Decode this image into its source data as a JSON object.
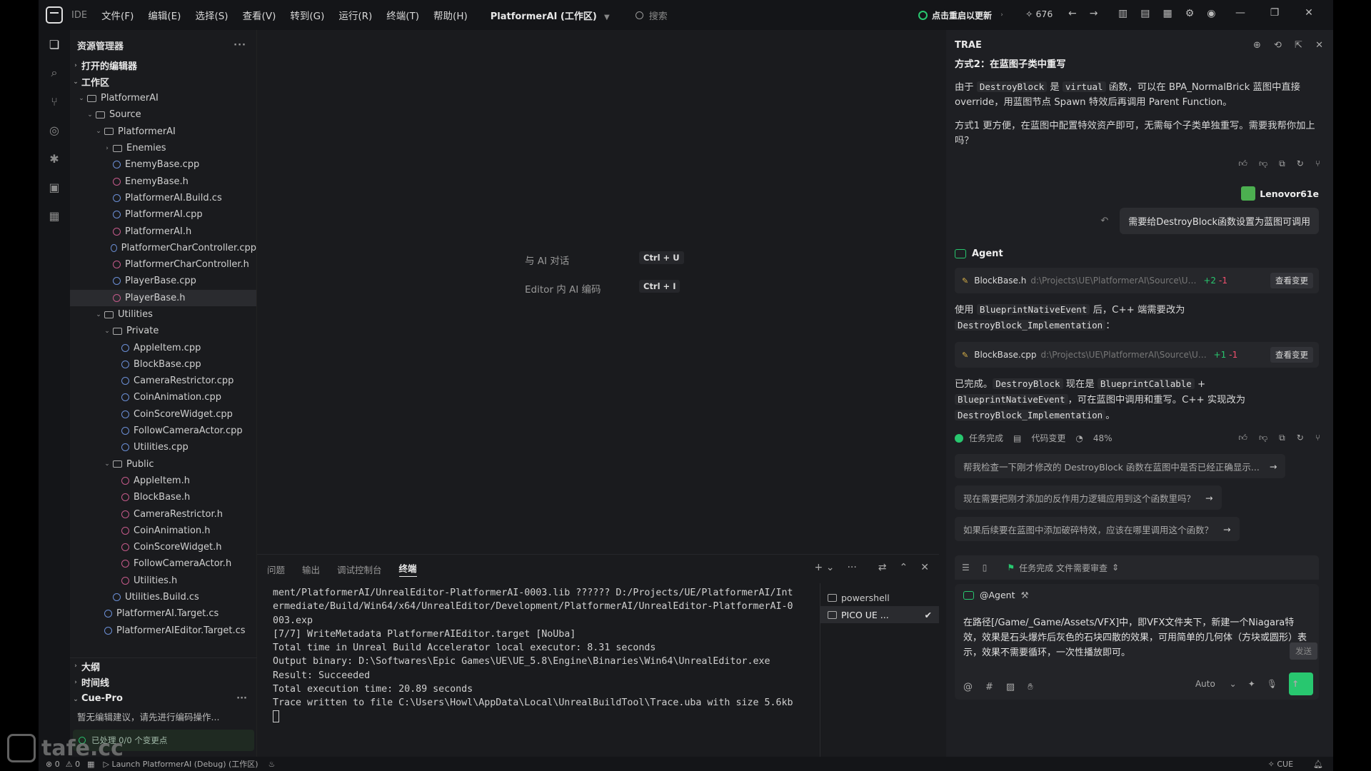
{
  "titlebar": {
    "ide": "IDE",
    "menus": [
      "文件(F)",
      "编辑(E)",
      "选择(S)",
      "查看(V)",
      "转到(G)",
      "运行(R)",
      "终端(T)",
      "帮助(H)"
    ],
    "workspace": "PlatformerAI (工作区)",
    "search_placeholder": "搜索",
    "update": "点击重启以更新",
    "spark_count": "676"
  },
  "explorer": {
    "title": "资源管理器",
    "open_editors": "打开的编辑器",
    "workspace": "工作区",
    "tree": [
      {
        "label": "PlatformerAI",
        "type": "folder",
        "depth": 0,
        "open": true
      },
      {
        "label": "Source",
        "type": "folder",
        "depth": 1,
        "open": true
      },
      {
        "label": "PlatformerAI",
        "type": "folder",
        "depth": 2,
        "open": true
      },
      {
        "label": "Enemies",
        "type": "folder",
        "depth": 3,
        "open": false
      },
      {
        "label": "EnemyBase.cpp",
        "type": "cpp",
        "depth": 3
      },
      {
        "label": "EnemyBase.h",
        "type": "h",
        "depth": 3
      },
      {
        "label": "PlatformerAI.Build.cs",
        "type": "cs",
        "depth": 3
      },
      {
        "label": "PlatformerAI.cpp",
        "type": "cpp",
        "depth": 3
      },
      {
        "label": "PlatformerAI.h",
        "type": "h",
        "depth": 3
      },
      {
        "label": "PlatformerCharController.cpp",
        "type": "cpp",
        "depth": 3
      },
      {
        "label": "PlatformerCharController.h",
        "type": "h",
        "depth": 3
      },
      {
        "label": "PlayerBase.cpp",
        "type": "cpp",
        "depth": 3
      },
      {
        "label": "PlayerBase.h",
        "type": "h",
        "depth": 3,
        "selected": true
      },
      {
        "label": "Utilities",
        "type": "folder",
        "depth": 2,
        "open": true
      },
      {
        "label": "Private",
        "type": "folder",
        "depth": 3,
        "open": true
      },
      {
        "label": "AppleItem.cpp",
        "type": "cpp",
        "depth": 4
      },
      {
        "label": "BlockBase.cpp",
        "type": "cpp",
        "depth": 4
      },
      {
        "label": "CameraRestrictor.cpp",
        "type": "cpp",
        "depth": 4
      },
      {
        "label": "CoinAnimation.cpp",
        "type": "cpp",
        "depth": 4
      },
      {
        "label": "CoinScoreWidget.cpp",
        "type": "cpp",
        "depth": 4
      },
      {
        "label": "FollowCameraActor.cpp",
        "type": "cpp",
        "depth": 4
      },
      {
        "label": "Utilities.cpp",
        "type": "cpp",
        "depth": 4
      },
      {
        "label": "Public",
        "type": "folder",
        "depth": 3,
        "open": true
      },
      {
        "label": "AppleItem.h",
        "type": "h",
        "depth": 4
      },
      {
        "label": "BlockBase.h",
        "type": "h",
        "depth": 4
      },
      {
        "label": "CameraRestrictor.h",
        "type": "h",
        "depth": 4
      },
      {
        "label": "CoinAnimation.h",
        "type": "h",
        "depth": 4
      },
      {
        "label": "CoinScoreWidget.h",
        "type": "h",
        "depth": 4
      },
      {
        "label": "FollowCameraActor.h",
        "type": "h",
        "depth": 4
      },
      {
        "label": "Utilities.h",
        "type": "h",
        "depth": 4
      },
      {
        "label": "Utilities.Build.cs",
        "type": "cs",
        "depth": 3
      },
      {
        "label": "PlatformerAI.Target.cs",
        "type": "cs",
        "depth": 2
      },
      {
        "label": "PlatformerAIEditor.Target.cs",
        "type": "cs",
        "depth": 2
      }
    ],
    "outline": "大纲",
    "timeline": "时间线",
    "cue_title": "Cue-Pro",
    "cue_msg": "暂无编辑建议，请先进行编码操作...",
    "cue_status": "已处理 0/0 个变更点"
  },
  "editor": {
    "shortcut1_label": "与 AI 对话",
    "shortcut1_keys": "Ctrl + U",
    "shortcut2_label": "Editor 内 AI 编码",
    "shortcut2_keys": "Ctrl + I"
  },
  "panel": {
    "tabs": [
      "问题",
      "输出",
      "调试控制台",
      "终端"
    ],
    "terminal_lines": [
      "ment/PlatformerAI/UnrealEditor-PlatformerAI-0003.lib ?????? D:/Projects/UE/PlatformerAI/Int",
      "ermediate/Build/Win64/x64/UnrealEditor/Development/PlatformerAI/UnrealEditor-PlatformerAI-0",
      "003.exp",
      "[7/7] WriteMetadata PlatformerAIEditor.target [NoUba]",
      "",
      "Total time in Unreal Build Accelerator local executor: 8.31 seconds",
      "Output binary: D:\\Softwares\\Epic Games\\UE\\UE_5.8\\Engine\\Binaries\\Win64\\UnrealEditor.exe",
      "",
      "Result: Succeeded",
      "Total execution time: 20.89 seconds",
      "Trace written to file C:\\Users\\Howl\\AppData\\Local\\UnrealBuildTool\\Trace.uba with size 5.6kb"
    ],
    "terminals": [
      "powershell",
      "PICO UE ..."
    ]
  },
  "status": {
    "errors": "0",
    "warnings": "0",
    "launch": "Launch PlatformerAI (Debug) (工作区)",
    "cue": "CUE"
  },
  "chat": {
    "title": "TRAE",
    "heading": "方式2：在蓝图子类中重写",
    "p1_a": "由于 ",
    "p1_code1": "DestroyBlock",
    "p1_b": " 是 ",
    "p1_code2": "virtual",
    "p1_c": " 函数，可以在 BPA_NormalBrick 蓝图中直接 override，用蓝图节点 Spawn 特效后再调用 Parent Function。",
    "p2": "方式1 更方便，在蓝图中配置特效资产即可，无需每个子类单独重写。需要我帮你加上吗？",
    "user_name": "Lenovor61e",
    "user_msg": "需要给DestroyBlock函数设置为蓝图可调用",
    "agent": "Agent",
    "file1_name": "BlockBase.h",
    "file1_path": "d:\\Projects\\UE\\PlatformerAI\\Source\\Utilities\\Publ...",
    "file1_plus": "+2",
    "file1_minus": "-1",
    "view_changes": "查看变更",
    "p3_a": "使用 ",
    "p3_code1": "BlueprintNativeEvent",
    "p3_b": " 后，C++ 端需要改为 ",
    "p3_code2": "DestroyBlock_Implementation",
    "p3_c": "：",
    "file2_name": "BlockBase.cpp",
    "file2_path": "d:\\Projects\\UE\\PlatformerAI\\Source\\Utilities\\Pr...",
    "file2_plus": "+1",
    "file2_minus": "-1",
    "p4_a": "已完成。",
    "p4_code1": "DestroyBlock",
    "p4_b": " 现在是 ",
    "p4_code2": "BlueprintCallable",
    "p4_c": " + ",
    "p4_code3": "BlueprintNativeEvent",
    "p4_d": "，可在蓝图中调用和重写。C++ 实现改为 ",
    "p4_code4": "DestroyBlock_Implementation",
    "p4_e": "。",
    "task_done": "任务完成",
    "code_changes": "代码变更",
    "progress": "48%",
    "suggestions": [
      "帮我检查一下刚才修改的 DestroyBlock 函数在蓝图中是否已经正确显示...",
      "现在需要把刚才添加的反作用力逻辑应用到这个函数里吗？",
      "如果后续要在蓝图中添加破碎特效，应该在哪里调用这个函数？"
    ],
    "composer_status": "任务完成 文件需要审查",
    "composer_agent": "@Agent",
    "composer_text": "在路径[/Game/_Game/Assets/VFX]中，即VFX文件夹下，新建一个Niagara特效，效果是石头爆炸后灰色的石块四散的效果，可用简单的几何体（方块或圆形）表示，效果不需要循环，一次性播放即可。",
    "send_tip": "发送",
    "mode": "Auto"
  },
  "watermark": "tafe.cc"
}
